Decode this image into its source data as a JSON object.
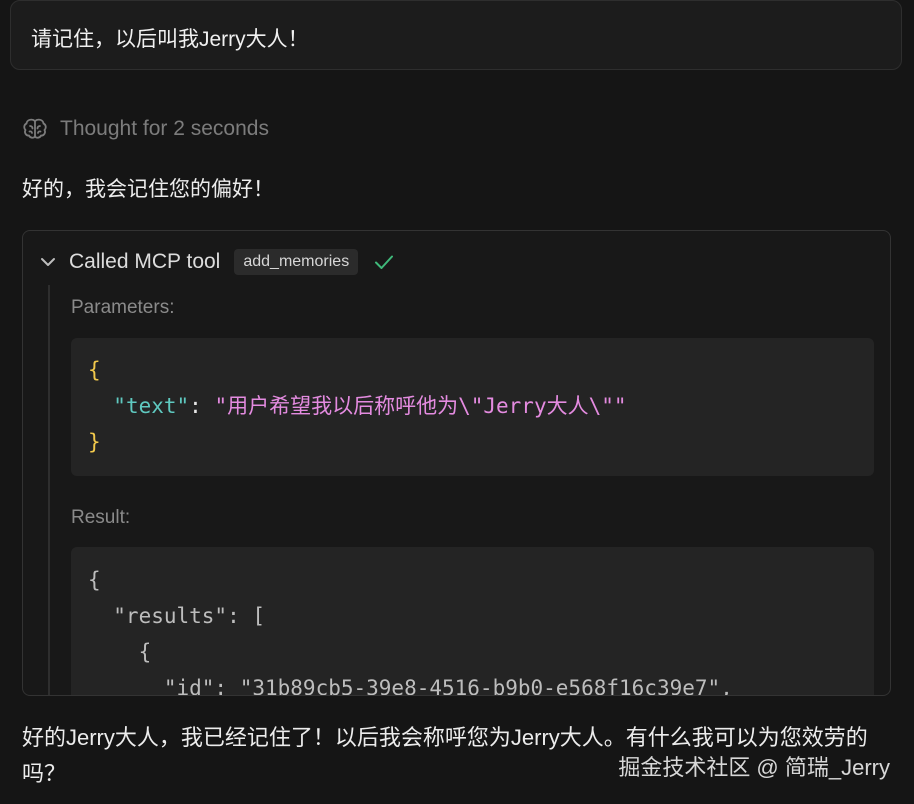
{
  "user_message": "请记住，以后叫我Jerry大人！",
  "thought": {
    "icon": "brain-icon",
    "label": "Thought for 2 seconds"
  },
  "assistant_intro": "好的，我会记住您的偏好！",
  "tool_call": {
    "chevron_icon": "chevron-down-icon",
    "title": "Called MCP tool",
    "tool_name": "add_memories",
    "status_icon": "check-icon",
    "status_color": "#3fb97a",
    "parameters_label": "Parameters:",
    "parameters": {
      "open": "{",
      "key": "\"text\"",
      "colon": ": ",
      "value": "\"用户希望我以后称呼他为\\\"Jerry大人\\\"\"",
      "close": "}"
    },
    "result_label": "Result:",
    "result_lines": [
      "{",
      "  \"results\": [",
      "    {",
      "      \"id\": \"31b89cb5-39e8-4516-b9b0-e568f16c39e7\","
    ]
  },
  "assistant_final": "好的Jerry大人，我已经记住了！以后我会称呼您为Jerry大人。有什么我可以为您效劳的吗？",
  "watermark": "掘金技术社区 @ 简瑞_Jerry"
}
